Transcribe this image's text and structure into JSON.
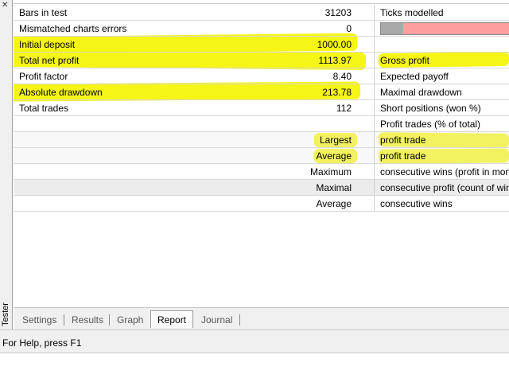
{
  "sidebar": {
    "label": "Tester",
    "close": "✕"
  },
  "rows": [
    {
      "label": "Bars in test",
      "value": "31203",
      "right": "Ticks modelled"
    },
    {
      "label": "Mismatched charts errors",
      "value": "0",
      "right": ""
    },
    {
      "label": "Initial deposit",
      "value": "1000.00",
      "right": ""
    },
    {
      "label": "Total net profit",
      "value": "1113.97",
      "right": "Gross profit"
    },
    {
      "label": "Profit factor",
      "value": "8.40",
      "right": "Expected payoff"
    },
    {
      "label": "Absolute drawdown",
      "value": "213.78",
      "right": "Maximal drawdown"
    },
    {
      "label": "Total trades",
      "value": "112",
      "right": "Short positions (won %)"
    },
    {
      "label": "",
      "value": "",
      "right": "Profit trades (% of total)"
    },
    {
      "label": "",
      "value": "Largest",
      "right": "profit trade"
    },
    {
      "label": "",
      "value": "Average",
      "right": "profit trade"
    },
    {
      "label": "",
      "value": "Maximum",
      "right": "consecutive wins (profit in money)"
    },
    {
      "label": "",
      "value": "Maximal",
      "right": "consecutive profit (count of wins)"
    },
    {
      "label": "",
      "value": "Average",
      "right": "consecutive wins"
    }
  ],
  "modelling_quality_fraction": 0.17,
  "colors": {
    "highlight": "#f5f50a",
    "bar_fill": "#a9a9a9",
    "bar_bg": "#ff9e9e"
  },
  "tabs": [
    {
      "label": "Settings"
    },
    {
      "label": "Results"
    },
    {
      "label": "Graph"
    },
    {
      "label": "Report",
      "active": true
    },
    {
      "label": "Journal"
    }
  ],
  "status": {
    "text": "For Help, press F1"
  }
}
